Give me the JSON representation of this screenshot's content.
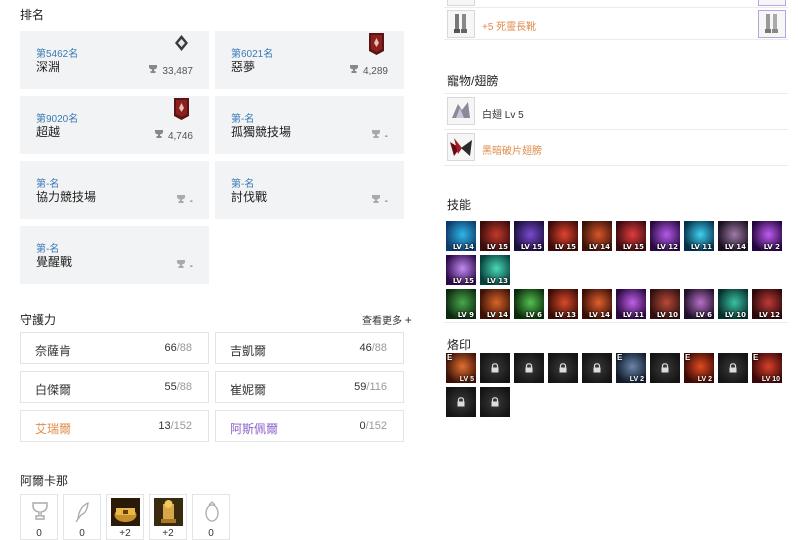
{
  "ranking": {
    "title": "排名",
    "cards": [
      {
        "pos": "第5462名",
        "name": "深淵",
        "score": "33,487",
        "emblem": "diamond-emblem-icon"
      },
      {
        "pos": "第6021名",
        "name": "惡夢",
        "score": "4,289",
        "emblem": "red-banner-emblem-icon"
      },
      {
        "pos": "第9020名",
        "name": "超越",
        "score": "4,746",
        "emblem": "red-banner-emblem-icon"
      },
      {
        "pos": "第-名",
        "name": "孤獨競技場",
        "score": "-"
      },
      {
        "pos": "第-名",
        "name": "協力競技場",
        "score": "-"
      },
      {
        "pos": "第-名",
        "name": "討伐戰",
        "score": "-"
      },
      {
        "pos": "第-名",
        "name": "覺醒戰",
        "score": "-"
      }
    ]
  },
  "guardian": {
    "title": "守護力",
    "more": "查看更多",
    "items": [
      {
        "name": "奈薩肯",
        "cur": "66",
        "max": "/88",
        "color": "#333333"
      },
      {
        "name": "吉凱爾",
        "cur": "46",
        "max": "/88",
        "color": "#333333"
      },
      {
        "name": "白傑爾",
        "cur": "55",
        "max": "/88",
        "color": "#333333"
      },
      {
        "name": "崔妮爾",
        "cur": "59",
        "max": "/116",
        "color": "#333333"
      },
      {
        "name": "艾瑞爾",
        "cur": "13",
        "max": "/152",
        "color": "#e08a48"
      },
      {
        "name": "阿斯佩爾",
        "cur": "0",
        "max": "/152",
        "color": "#8a5fc9"
      }
    ]
  },
  "arcana": {
    "title": "阿爾卡那",
    "items": [
      {
        "icon": "trophy-outline-icon",
        "value": "0"
      },
      {
        "icon": "feather-outline-icon",
        "value": "0"
      },
      {
        "icon": "golden-chest-icon",
        "value": "+2"
      },
      {
        "icon": "golden-statue-icon",
        "value": "+2"
      },
      {
        "icon": "ring-outline-icon",
        "value": "0"
      }
    ]
  },
  "equipment": {
    "boots_label": "+5 死靈長靴",
    "boots_color": "#e08a48"
  },
  "pet_wings": {
    "title": "寵物/翅膀",
    "pet": "白翅 Lv 5",
    "wings": "黑暗破片翅膀",
    "wings_color": "#e08a48"
  },
  "skills": {
    "title": "技能",
    "row1": [
      {
        "lv": "LV 14",
        "c1": "#0c3b6b",
        "c2": "#2fb6e8"
      },
      {
        "lv": "LV 15",
        "c1": "#3a0c0c",
        "c2": "#c23a2a"
      },
      {
        "lv": "LV 15",
        "c1": "#1c0f3a",
        "c2": "#7a4ad0"
      },
      {
        "lv": "LV 15",
        "c1": "#3b0a0a",
        "c2": "#e0452d"
      },
      {
        "lv": "LV 14",
        "c1": "#3a120a",
        "c2": "#d8552a"
      },
      {
        "lv": "LV 15",
        "c1": "#3a0a10",
        "c2": "#e23d3d"
      },
      {
        "lv": "LV 12",
        "c1": "#2a0a44",
        "c2": "#b35be8"
      },
      {
        "lv": "LV 11",
        "c1": "#06304a",
        "c2": "#3fd0f0"
      },
      {
        "lv": "LV 14",
        "c1": "#1a1020",
        "c2": "#a07aa8"
      },
      {
        "lv": "LV 2",
        "c1": "#24063f",
        "c2": "#c05cf0"
      }
    ],
    "row2": [
      {
        "lv": "LV 15",
        "c1": "#2c0a4a",
        "c2": "#c48af0"
      },
      {
        "lv": "LV 13",
        "c1": "#07403a",
        "c2": "#4ad8b8"
      }
    ],
    "row3": [
      {
        "lv": "LV 9",
        "c1": "#0c2a10",
        "c2": "#4aa84a"
      },
      {
        "lv": "LV 14",
        "c1": "#3a1206",
        "c2": "#d8642a"
      },
      {
        "lv": "LV 6",
        "c1": "#0a2a0a",
        "c2": "#54c050"
      },
      {
        "lv": "LV 13",
        "c1": "#3a0c06",
        "c2": "#d84a2a"
      },
      {
        "lv": "LV 14",
        "c1": "#3a0e06",
        "c2": "#e0602e"
      },
      {
        "lv": "LV 11",
        "c1": "#2a0840",
        "c2": "#c060e8"
      },
      {
        "lv": "LV 10",
        "c1": "#301010",
        "c2": "#b84a38"
      },
      {
        "lv": "LV 6",
        "c1": "#20102a",
        "c2": "#b870c8"
      },
      {
        "lv": "LV 10",
        "c1": "#06302c",
        "c2": "#3ac0a4"
      },
      {
        "lv": "LV 12",
        "c1": "#2a0808",
        "c2": "#c03a3a"
      }
    ]
  },
  "runes": {
    "title": "烙印",
    "row1": [
      {
        "locked": false,
        "e": "E",
        "lv": "LV 5",
        "c1": "#3a1006",
        "c2": "#e07030"
      },
      {
        "locked": true
      },
      {
        "locked": true
      },
      {
        "locked": true
      },
      {
        "locked": true
      },
      {
        "locked": false,
        "e": "E",
        "lv": "LV 2",
        "c1": "#101a2a",
        "c2": "#6a84a8"
      },
      {
        "locked": true
      },
      {
        "locked": false,
        "e": "E",
        "lv": "LV 2",
        "c1": "#3a0a06",
        "c2": "#e04a20"
      },
      {
        "locked": true
      },
      {
        "locked": false,
        "e": "E",
        "lv": "LV 10",
        "c1": "#3a0808",
        "c2": "#d8402a"
      }
    ],
    "row2": [
      {
        "locked": true
      },
      {
        "locked": true
      }
    ]
  }
}
